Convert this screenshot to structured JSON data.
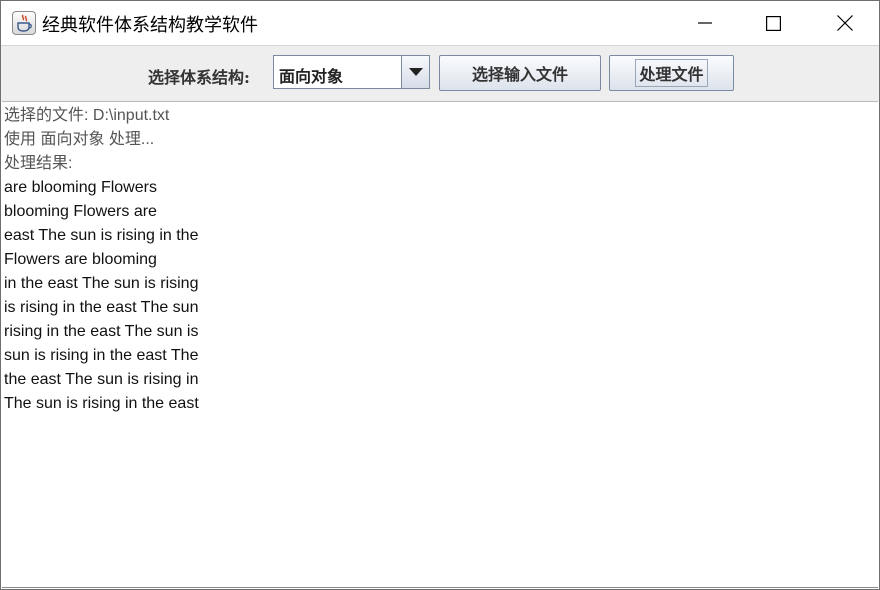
{
  "window": {
    "title": "经典软件体系结构教学软件",
    "icon": "java-cup-icon"
  },
  "toolbar": {
    "arch_label": "选择体系结构:",
    "arch_selected": "面向对象",
    "select_file_label": "选择输入文件",
    "process_label": "处理文件"
  },
  "output": {
    "lines": [
      "选择的文件: D:\\input.txt",
      "使用 面向对象 处理...",
      "处理结果:",
      "are blooming Flowers",
      "blooming Flowers are",
      "east The sun is rising in the",
      "Flowers are blooming",
      "in the east The sun is rising",
      "is rising in the east The sun",
      "rising in the east The sun is",
      "sun is rising in the east The",
      "the east The sun is rising in",
      "The sun is rising in the east"
    ]
  }
}
